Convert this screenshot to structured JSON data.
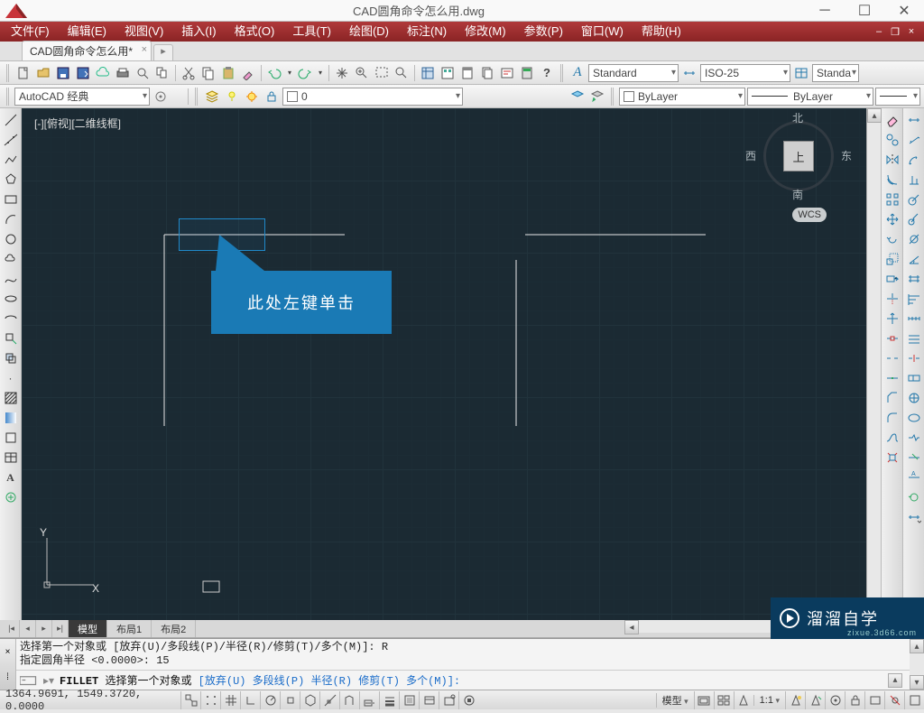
{
  "title": "CAD圆角命令怎么用.dwg",
  "menu": [
    "文件(F)",
    "编辑(E)",
    "视图(V)",
    "插入(I)",
    "格式(O)",
    "工具(T)",
    "绘图(D)",
    "标注(N)",
    "修改(M)",
    "参数(P)",
    "窗口(W)",
    "帮助(H)"
  ],
  "doc_tab": "CAD圆角命令怎么用*",
  "toolbar2": {
    "workspace": "AutoCAD 经典",
    "layer": "0",
    "bylayer": "ByLayer",
    "linetype": "ByLayer",
    "textstyle": "Standard",
    "dimstyle": "ISO-25",
    "tablestyle": "Standa"
  },
  "viewcube": {
    "n": "北",
    "s": "南",
    "e": "东",
    "w": "西",
    "top": "上",
    "wcs": "WCS"
  },
  "vp_label": "[-][俯视][二维线框]",
  "callout": "此处左键单击",
  "ucs": {
    "x": "X",
    "y": "Y"
  },
  "layout_tabs": {
    "model": "模型",
    "l1": "布局1",
    "l2": "布局2"
  },
  "cmd_hist": [
    "选择第一个对象或 [放弃(U)/多段线(P)/半径(R)/修剪(T)/多个(M)]: R",
    "指定圆角半径 <0.0000>: 15"
  ],
  "cmd": {
    "name": "FILLET",
    "prompt": "选择第一个对象或 ",
    "opts": "[放弃(U) 多段线(P) 半径(R) 修剪(T) 多个(M)]:"
  },
  "status": {
    "coords": "1364.9691, 1549.3720, 0.0000",
    "model": "模型",
    "scale": "1:1",
    "ws_icon": "⚙"
  },
  "watermark": {
    "t1": "溜溜自学",
    "url": "zixue.3d66.com"
  }
}
